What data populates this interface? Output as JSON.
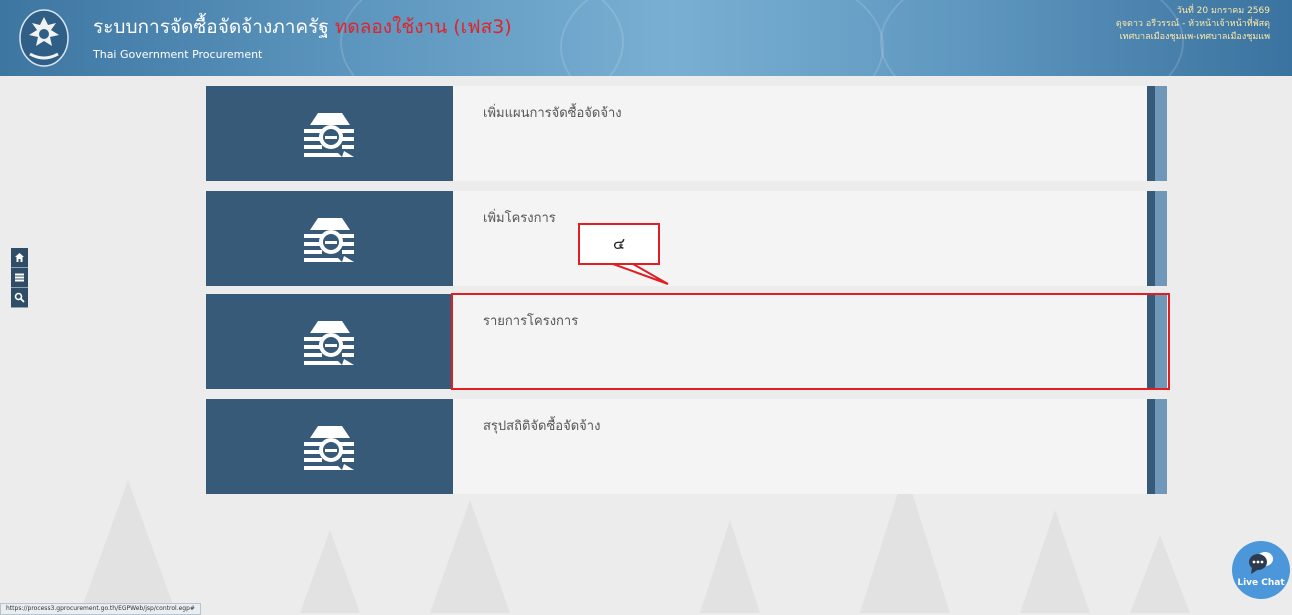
{
  "header": {
    "title": "ระบบการจัดซื้อจัดจ้างภาครัฐ",
    "trial_label": "ทดลองใช้งาน (เฟส3)",
    "subtitle": "Thai Government Procurement",
    "date": "วันที่ 20 มกราคม 2569",
    "user": "ดุจดาว อรีวรรณ์ - หัวหน้าเจ้าหน้าที่พัสดุ",
    "agency": "เทศบาลเมืองชุมแพ-เทศบาลเมืองชุมแพ"
  },
  "side_tools": {
    "home": "home-icon",
    "menu": "menu-icon",
    "search": "search-icon"
  },
  "menu": {
    "items": [
      {
        "label": "เพิ่มแผนการจัดซื้อจัดจ้าง",
        "icon": "procurement-icon"
      },
      {
        "label": "เพิ่มโครงการ",
        "icon": "procurement-icon"
      },
      {
        "label": "รายการโครงการ",
        "icon": "procurement-icon"
      },
      {
        "label": "สรุปสถิติจัดซื้อจัดจ้าง",
        "icon": "procurement-icon"
      }
    ]
  },
  "annotation": {
    "step": "๔",
    "color": "#e01e24"
  },
  "live_chat": {
    "label": "Live Chat"
  },
  "status_bar": {
    "url": "https://process3.gprocurement.go.th/EGPWeb/jsp/control.egp#"
  },
  "colors": {
    "icon_panel": "#365a78",
    "strip_light": "#6f98b8",
    "card_background": "#f4f4f4"
  }
}
